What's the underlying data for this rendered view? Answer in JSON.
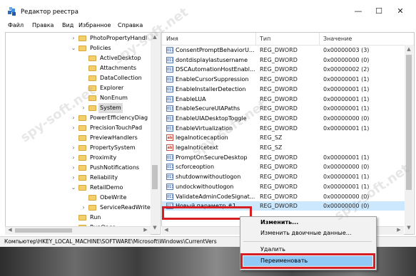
{
  "window": {
    "title": "Редактор реестра",
    "controls": {
      "minimize": "—",
      "maximize": "☐",
      "close": "✕"
    }
  },
  "menu": [
    "Файл",
    "Правка",
    "Вид",
    "Избранное",
    "Справка"
  ],
  "tree": {
    "items": [
      {
        "label": "PhotoPropertyHandl",
        "expander": "›"
      },
      {
        "label": "Policies",
        "expander": "⌄"
      },
      {
        "label": "ActiveDesktop",
        "expander": ""
      },
      {
        "label": "Attachments",
        "expander": ""
      },
      {
        "label": "DataCollection",
        "expander": ""
      },
      {
        "label": "Explorer",
        "expander": ""
      },
      {
        "label": "NonEnum",
        "expander": ""
      },
      {
        "label": "System",
        "expander": "›"
      },
      {
        "label": "PowerEfficiencyDiag",
        "expander": "›"
      },
      {
        "label": "PrecisionTouchPad",
        "expander": "›"
      },
      {
        "label": "PreviewHandlers",
        "expander": ""
      },
      {
        "label": "PropertySystem",
        "expander": "›"
      },
      {
        "label": "Proximity",
        "expander": "›"
      },
      {
        "label": "PushNotifications",
        "expander": "›"
      },
      {
        "label": "Reliability",
        "expander": "›"
      },
      {
        "label": "RetailDemo",
        "expander": "⌄"
      },
      {
        "label": "ObeWrite",
        "expander": ""
      },
      {
        "label": "ServiceReadWrite",
        "expander": "›"
      },
      {
        "label": "Run",
        "expander": ""
      },
      {
        "label": "RunOnce",
        "expander": ""
      }
    ]
  },
  "list": {
    "columns": {
      "name": "Имя",
      "type": "Тип",
      "value": "Значение"
    },
    "rows": [
      {
        "icon": "reg-binary-icon",
        "icon_text": "011",
        "name": "ConsentPromptBehaviorU...",
        "type": "REG_DWORD",
        "value": "0x00000003 (3)"
      },
      {
        "icon": "reg-binary-icon",
        "icon_text": "011",
        "name": "dontdisplaylastusername",
        "type": "REG_DWORD",
        "value": "0x00000000 (0)"
      },
      {
        "icon": "reg-binary-icon",
        "icon_text": "011",
        "name": "DSCAutomationHostEnabl...",
        "type": "REG_DWORD",
        "value": "0x00000002 (2)"
      },
      {
        "icon": "reg-binary-icon",
        "icon_text": "011",
        "name": "EnableCursorSuppression",
        "type": "REG_DWORD",
        "value": "0x00000001 (1)"
      },
      {
        "icon": "reg-binary-icon",
        "icon_text": "011",
        "name": "EnableInstallerDetection",
        "type": "REG_DWORD",
        "value": "0x00000001 (1)"
      },
      {
        "icon": "reg-binary-icon",
        "icon_text": "011",
        "name": "EnableLUA",
        "type": "REG_DWORD",
        "value": "0x00000001 (1)"
      },
      {
        "icon": "reg-binary-icon",
        "icon_text": "011",
        "name": "EnableSecureUIAPaths",
        "type": "REG_DWORD",
        "value": "0x00000001 (1)"
      },
      {
        "icon": "reg-binary-icon",
        "icon_text": "011",
        "name": "EnableUIADesktopToggle",
        "type": "REG_DWORD",
        "value": "0x00000000 (0)"
      },
      {
        "icon": "reg-binary-icon",
        "icon_text": "011",
        "name": "EnableVirtualization",
        "type": "REG_DWORD",
        "value": "0x00000001 (1)"
      },
      {
        "icon": "reg-string-icon",
        "icon_text": "ab",
        "name": "legalnoticecaption",
        "type": "REG_SZ",
        "value": ""
      },
      {
        "icon": "reg-string-icon",
        "icon_text": "ab",
        "name": "legalnoticetext",
        "type": "REG_SZ",
        "value": ""
      },
      {
        "icon": "reg-binary-icon",
        "icon_text": "011",
        "name": "PromptOnSecureDesktop",
        "type": "REG_DWORD",
        "value": "0x00000001 (1)"
      },
      {
        "icon": "reg-binary-icon",
        "icon_text": "011",
        "name": "scforceoption",
        "type": "REG_DWORD",
        "value": "0x00000000 (0)"
      },
      {
        "icon": "reg-binary-icon",
        "icon_text": "011",
        "name": "shutdownwithoutlogon",
        "type": "REG_DWORD",
        "value": "0x00000001 (1)"
      },
      {
        "icon": "reg-binary-icon",
        "icon_text": "011",
        "name": "undockwithoutlogon",
        "type": "REG_DWORD",
        "value": "0x00000001 (1)"
      },
      {
        "icon": "reg-binary-icon",
        "icon_text": "011",
        "name": "ValidateAdminCodeSignat...",
        "type": "REG_DWORD",
        "value": "0x00000000 (0)"
      },
      {
        "icon": "reg-binary-icon",
        "icon_text": "011",
        "name": "Новый параметр #1",
        "type": "REG_DWORD",
        "value": "0x00000000 (0)"
      }
    ]
  },
  "status": {
    "path": "Компьютер\\HKEY_LOCAL_MACHINE\\SOFTWARE\\Microsoft\\Windows\\CurrentVers"
  },
  "context_menu": {
    "items": [
      "Изменить...",
      "Изменить двоичные данные...",
      "Удалить",
      "Переименовать"
    ]
  },
  "watermark": "spy-soft.net",
  "colors": {
    "highlight_red": "#d81e25",
    "selection_blue": "#91c9f7",
    "row_highlight": "#cce8ff"
  }
}
